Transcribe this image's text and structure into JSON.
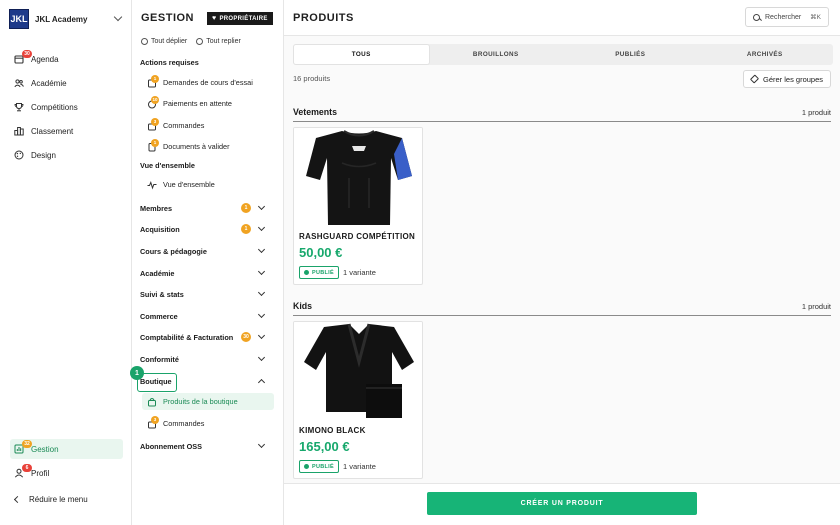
{
  "brand": {
    "logo": "JKL",
    "name": "JKL Academy"
  },
  "rail": {
    "items": [
      {
        "label": "Agenda",
        "icon": "calendar-icon",
        "badge": "30"
      },
      {
        "label": "Académie",
        "icon": "users-icon"
      },
      {
        "label": "Compétitions",
        "icon": "trophy-icon"
      },
      {
        "label": "Classement",
        "icon": "ranking-icon"
      },
      {
        "label": "Design",
        "icon": "palette-icon"
      }
    ],
    "bottom": [
      {
        "label": "Gestion",
        "icon": "chart-icon",
        "badge": "32"
      },
      {
        "label": "Profil",
        "icon": "user-icon",
        "badge": "6"
      }
    ],
    "collapse_label": "Réduire le menu"
  },
  "panel": {
    "title": "GESTION",
    "owner_badge": "PROPRIÉTAIRE",
    "expand_all": "Tout déplier",
    "collapse_all": "Tout replier",
    "actions_title": "Actions requises",
    "actions": [
      {
        "label": "Demandes de cours d'essai",
        "badge": "1"
      },
      {
        "label": "Paiements en attente",
        "badge": "10"
      },
      {
        "label": "Commandes",
        "badge": "3"
      },
      {
        "label": "Documents à valider",
        "badge": "1"
      }
    ],
    "overview_title": "Vue d'ensemble",
    "overview_item": "Vue d'ensemble",
    "sections": [
      {
        "label": "Membres",
        "badge": "1"
      },
      {
        "label": "Acquisition",
        "badge": "1"
      },
      {
        "label": "Cours & pédagogie"
      },
      {
        "label": "Académie"
      },
      {
        "label": "Suivi & stats"
      },
      {
        "label": "Commerce"
      },
      {
        "label": "Comptabilité & Facturation",
        "badge": "30"
      },
      {
        "label": "Conformité"
      },
      {
        "label": "Boutique",
        "expanded": true
      },
      {
        "label": "Abonnement OSS"
      }
    ],
    "boutique_items": [
      {
        "label": "Produits de la boutique"
      },
      {
        "label": "Commandes",
        "badge": "3"
      }
    ],
    "step_marker": "1"
  },
  "main": {
    "title": "PRODUITS",
    "search_label": "Rechercher",
    "search_shortcut": "⌘K",
    "tabs": [
      "TOUS",
      "BROUILLONS",
      "PUBLIÉS",
      "ARCHIVÉS"
    ],
    "active_tab": "TOUS",
    "product_count": "16 produits",
    "groups_button": "Gérer les groupes",
    "categories": [
      {
        "name": "Vetements",
        "count": "1 produit",
        "products": [
          {
            "name": "RASHGUARD COMPÉTITION",
            "price": "50,00 €",
            "status": "PUBLIÉ",
            "variants": "1 variante",
            "image": "rashguard"
          }
        ]
      },
      {
        "name": "Kids",
        "count": "1 produit",
        "products": [
          {
            "name": "KIMONO BLACK",
            "price": "165,00 €",
            "status": "PUBLIÉ",
            "variants": "1 variante",
            "image": "kimono"
          }
        ]
      }
    ],
    "create_button": "CRÉER UN PRODUIT"
  },
  "colors": {
    "accent": "#17b477",
    "badge_red": "#e8423a",
    "badge_orange": "#f0a322",
    "brand_blue": "#1e3a8a"
  }
}
